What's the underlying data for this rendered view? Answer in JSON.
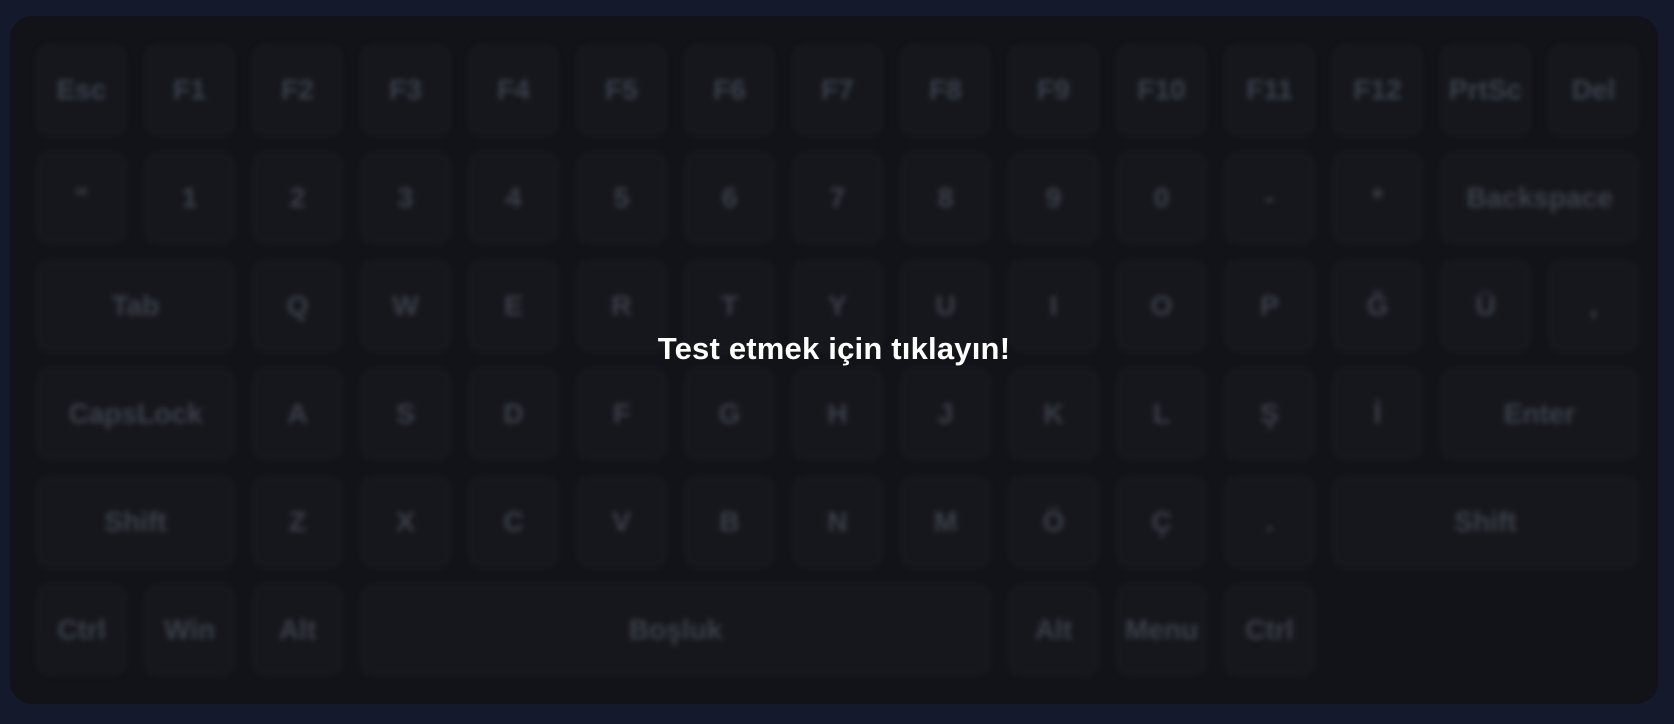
{
  "overlay": {
    "prompt": "Test etmek için tıklayın!"
  },
  "keyboard": {
    "rows": [
      {
        "keys": [
          {
            "label": "Esc",
            "units": 1
          },
          {
            "label": "F1",
            "units": 1
          },
          {
            "label": "F2",
            "units": 1
          },
          {
            "label": "F3",
            "units": 1
          },
          {
            "label": "F4",
            "units": 1
          },
          {
            "label": "F5",
            "units": 1
          },
          {
            "label": "F6",
            "units": 1
          },
          {
            "label": "F7",
            "units": 1
          },
          {
            "label": "F8",
            "units": 1
          },
          {
            "label": "F9",
            "units": 1
          },
          {
            "label": "F10",
            "units": 1
          },
          {
            "label": "F11",
            "units": 1
          },
          {
            "label": "F12",
            "units": 1
          },
          {
            "label": "PrtSc",
            "units": 1
          },
          {
            "label": "Del",
            "units": 1
          }
        ]
      },
      {
        "keys": [
          {
            "label": "\"",
            "units": 1
          },
          {
            "label": "1",
            "units": 1
          },
          {
            "label": "2",
            "units": 1
          },
          {
            "label": "3",
            "units": 1
          },
          {
            "label": "4",
            "units": 1
          },
          {
            "label": "5",
            "units": 1
          },
          {
            "label": "6",
            "units": 1
          },
          {
            "label": "7",
            "units": 1
          },
          {
            "label": "8",
            "units": 1
          },
          {
            "label": "9",
            "units": 1
          },
          {
            "label": "0",
            "units": 1
          },
          {
            "label": "-",
            "units": 1
          },
          {
            "label": "*",
            "units": 1
          },
          {
            "label": "Backspace",
            "units": 2
          }
        ]
      },
      {
        "keys": [
          {
            "label": "Tab",
            "units": 2
          },
          {
            "label": "Q",
            "units": 1
          },
          {
            "label": "W",
            "units": 1
          },
          {
            "label": "E",
            "units": 1
          },
          {
            "label": "R",
            "units": 1
          },
          {
            "label": "T",
            "units": 1
          },
          {
            "label": "Y",
            "units": 1
          },
          {
            "label": "U",
            "units": 1
          },
          {
            "label": "I",
            "units": 1
          },
          {
            "label": "O",
            "units": 1
          },
          {
            "label": "P",
            "units": 1
          },
          {
            "label": "Ğ",
            "units": 1
          },
          {
            "label": "Ü",
            "units": 1
          },
          {
            "label": ",",
            "units": 1
          }
        ]
      },
      {
        "keys": [
          {
            "label": "CapsLock",
            "units": 2
          },
          {
            "label": "A",
            "units": 1
          },
          {
            "label": "S",
            "units": 1
          },
          {
            "label": "D",
            "units": 1
          },
          {
            "label": "F",
            "units": 1
          },
          {
            "label": "G",
            "units": 1
          },
          {
            "label": "H",
            "units": 1
          },
          {
            "label": "J",
            "units": 1
          },
          {
            "label": "K",
            "units": 1
          },
          {
            "label": "L",
            "units": 1
          },
          {
            "label": "Ş",
            "units": 1
          },
          {
            "label": "İ",
            "units": 1
          },
          {
            "label": "Enter",
            "units": 2
          }
        ]
      },
      {
        "keys": [
          {
            "label": "Shift",
            "units": 2
          },
          {
            "label": "Z",
            "units": 1
          },
          {
            "label": "X",
            "units": 1
          },
          {
            "label": "C",
            "units": 1
          },
          {
            "label": "V",
            "units": 1
          },
          {
            "label": "B",
            "units": 1
          },
          {
            "label": "N",
            "units": 1
          },
          {
            "label": "M",
            "units": 1
          },
          {
            "label": "Ö",
            "units": 1
          },
          {
            "label": "Ç",
            "units": 1
          },
          {
            "label": ".",
            "units": 1
          },
          {
            "label": "Shift",
            "units": 3
          }
        ]
      },
      {
        "keys": [
          {
            "label": "Ctrl",
            "units": 1
          },
          {
            "label": "Win",
            "units": 1
          },
          {
            "label": "Alt",
            "units": 1
          },
          {
            "label": "Boşluk",
            "units": 6
          },
          {
            "label": "Alt",
            "units": 1
          },
          {
            "label": "Menu",
            "units": 1
          },
          {
            "label": "Ctrl",
            "units": 1
          }
        ]
      }
    ]
  }
}
